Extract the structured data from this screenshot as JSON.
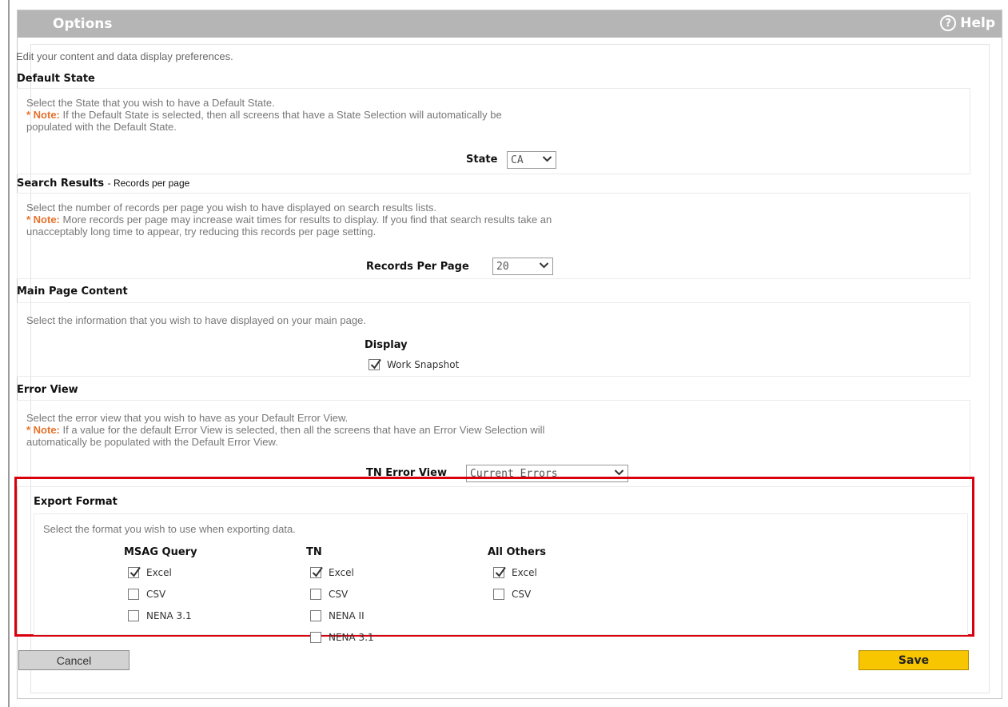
{
  "header": {
    "title": "Options",
    "help_label": "Help",
    "help_icon": "question-circle-icon"
  },
  "intro": "Edit your content and data display preferences.",
  "default_state": {
    "heading": "Default State",
    "description": "Select the State that you wish to have a Default State.",
    "note_label": "* Note:",
    "note_line1": "If the Default State is selected, then all screens that have a State Selection will automatically be",
    "note_line2": "populated with the Default State.",
    "field_label": "State",
    "value": "CA"
  },
  "search_results": {
    "heading": "Search Results",
    "subheading": "- Records per page",
    "description": "Select the number of records per page you wish to have displayed on search results lists.",
    "note_label": "* Note:",
    "note_line1": "More records per page may increase wait times for results to display. If you find that search results take an",
    "note_line2": "unacceptably long time to appear, try reducing this records per page setting.",
    "field_label": "Records Per Page",
    "value": "20"
  },
  "main_page_content": {
    "heading": "Main Page Content",
    "description": "Select the information that you wish to have displayed on your main page.",
    "display_label": "Display",
    "options": [
      {
        "label": "Work Snapshot",
        "checked": true
      }
    ]
  },
  "error_view": {
    "heading": "Error View",
    "description": "Select the error view that you wish to have as your Default Error View.",
    "note_label": "* Note:",
    "note_line1": "If a value for the default Error View is selected, then all the screens that have an Error View Selection will",
    "note_line2": "automatically be populated with the Default Error View.",
    "field_label": "TN Error View",
    "value": "Current Errors"
  },
  "export_format": {
    "heading": "Export Format",
    "description": "Select the format you wish to use when exporting data.",
    "columns": [
      {
        "title": "MSAG Query",
        "options": [
          {
            "label": "Excel",
            "checked": true
          },
          {
            "label": "CSV",
            "checked": false
          },
          {
            "label": "NENA 3.1",
            "checked": false
          }
        ]
      },
      {
        "title": "TN",
        "options": [
          {
            "label": "Excel",
            "checked": true
          },
          {
            "label": "CSV",
            "checked": false
          },
          {
            "label": "NENA II",
            "checked": false
          },
          {
            "label": "NENA 3.1",
            "checked": false
          }
        ]
      },
      {
        "title": "All Others",
        "options": [
          {
            "label": "Excel",
            "checked": true
          },
          {
            "label": "CSV",
            "checked": false
          }
        ]
      }
    ]
  },
  "actions": {
    "cancel_label": "Cancel",
    "save_label": "Save"
  },
  "colors": {
    "header_bg": "#b5b5b5",
    "note": "#e8702a",
    "highlight": "#d9000e",
    "save_bg": "#f7c600"
  }
}
